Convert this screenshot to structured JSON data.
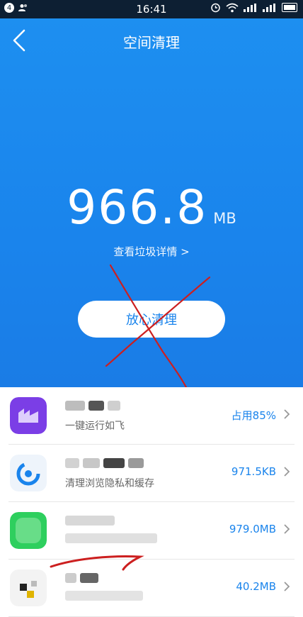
{
  "status": {
    "time": "16:41",
    "notification_count": "4"
  },
  "header": {
    "title": "空间清理"
  },
  "summary": {
    "value": "966.8",
    "unit": "MB",
    "details_link": "查看垃圾详情 >"
  },
  "actions": {
    "clean_label": "放心清理"
  },
  "apps": [
    {
      "desc": "一键运行如飞",
      "size": "占用85%"
    },
    {
      "desc": "清理浏览隐私和缓存",
      "size": "971.5KB"
    },
    {
      "desc": "",
      "size": "979.0MB"
    },
    {
      "desc": "",
      "size": "40.2MB"
    }
  ],
  "colors": {
    "accent": "#1a84ec",
    "status_bar": "#0d1f33",
    "annotation": "#cc1f1f"
  }
}
